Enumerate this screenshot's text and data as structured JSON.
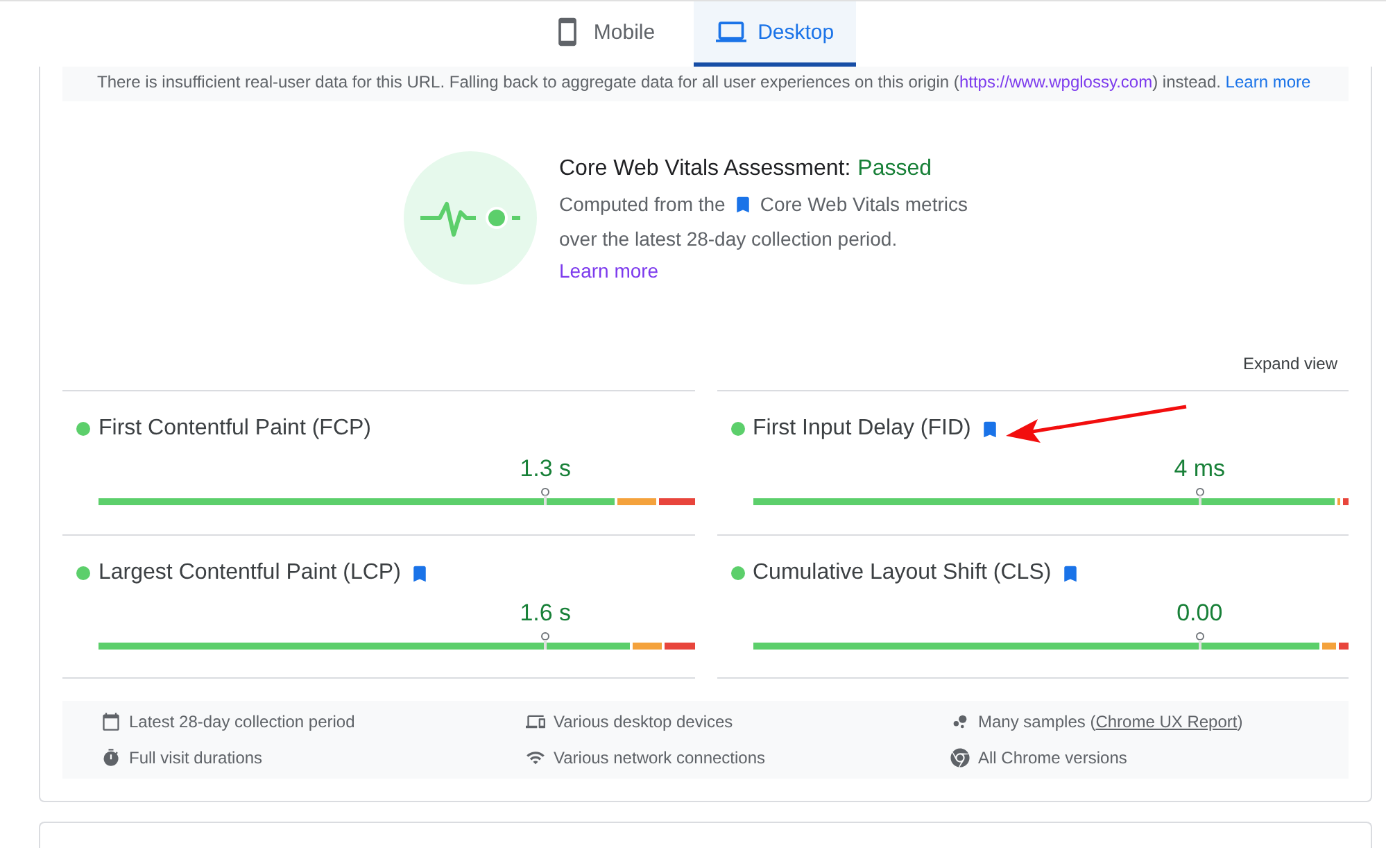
{
  "tabs": [
    {
      "label": "Mobile",
      "selected": false
    },
    {
      "label": "Desktop",
      "selected": true
    }
  ],
  "notice": {
    "text": "There is insufficient real-user data for this URL. Falling back to aggregate data for all user experiences on this origin (",
    "origin_link": "https://www.wpglossy.com",
    "text_after": ") instead.",
    "learn_more": "Learn more"
  },
  "assessment": {
    "title": "Core Web Vitals Assessment:",
    "result": "Passed",
    "passed": true,
    "text_before": "Computed from the",
    "metrics_label": "Core Web Vitals metrics",
    "text_after": "over the latest 28-day collection period.",
    "learn_more": "Learn more"
  },
  "expand_view": "Expand view",
  "metrics": [
    {
      "name": "First Contentful Paint (FCP)",
      "core": false,
      "value": "1.3 s",
      "marker": {
        "level": 0.75
      },
      "good_fill": {
        "level": 0.865
      },
      "needs_improvement_fill": {
        "level": 0.935
      }
    },
    {
      "name": "First Input Delay (FID)",
      "core": true,
      "value": "4 ms",
      "marker": {
        "level": 0.75
      },
      "good_fill": {
        "level": 0.977
      },
      "needs_improvement_fill": {
        "level": 0.986
      }
    },
    {
      "name": "Largest Contentful Paint (LCP)",
      "core": true,
      "value": "1.6 s",
      "marker": {
        "level": 0.75
      },
      "good_fill": {
        "level": 0.892
      },
      "needs_improvement_fill": {
        "level": 0.945
      }
    },
    {
      "name": "Cumulative Layout Shift (CLS)",
      "core": true,
      "value": "0.00",
      "marker": {
        "level": 0.75
      },
      "good_fill": {
        "level": 0.95
      },
      "needs_improvement_fill": {
        "level": 0.978
      }
    }
  ],
  "info": [
    {
      "text": "Latest 28-day collection period"
    },
    {
      "text": "Various desktop devices"
    },
    {
      "text": "Many samples (",
      "link": "Chrome UX Report",
      "text_after": ")"
    },
    {
      "text": "Full visit durations"
    },
    {
      "text": "Various network connections"
    },
    {
      "text": "All Chrome versions"
    }
  ]
}
